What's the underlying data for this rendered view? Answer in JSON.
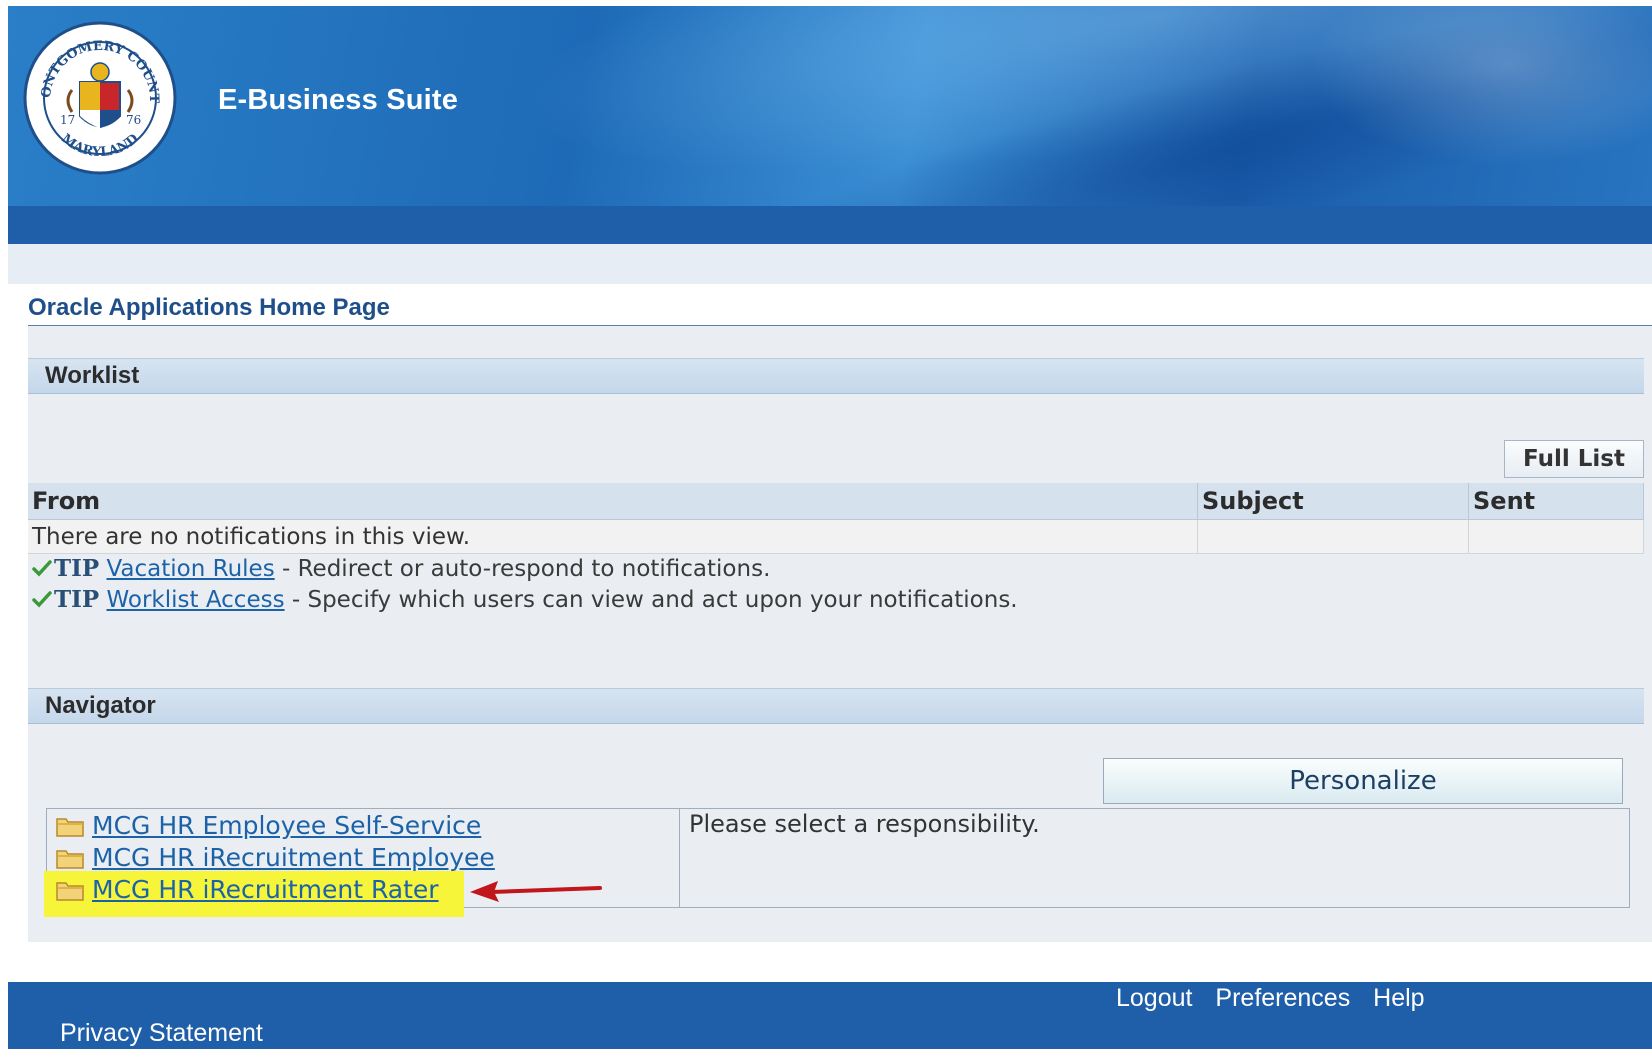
{
  "header": {
    "app_title": "E-Business Suite",
    "seal": {
      "top_text": "MONTGOMERY COUNTY",
      "bottom_text": "MARYLAND",
      "year_left": "17",
      "year_right": "76"
    }
  },
  "page": {
    "title": "Oracle Applications Home Page"
  },
  "worklist": {
    "section_title": "Worklist",
    "full_list_label": "Full List",
    "columns": [
      "From",
      "Subject",
      "Sent"
    ],
    "empty_message": "There are no notifications in this view.",
    "tips": [
      {
        "label": "TIP",
        "link": "Vacation Rules",
        "text": " - Redirect or auto-respond to notifications."
      },
      {
        "label": "TIP",
        "link": "Worklist Access",
        "text": " - Specify which users can view and act upon your notifications."
      }
    ]
  },
  "navigator": {
    "section_title": "Navigator",
    "personalize_label": "Personalize",
    "items": [
      {
        "label": "MCG HR Employee Self-Service"
      },
      {
        "label": "MCG HR iRecruitment Employee"
      },
      {
        "label": "MCG HR iRecruitment Rater",
        "highlighted": true
      }
    ],
    "message": "Please select a responsibility."
  },
  "footer": {
    "links": [
      "Logout",
      "Preferences",
      "Help"
    ],
    "privacy": "Privacy Statement"
  },
  "colors": {
    "header_blue": "#1f5ea8",
    "link": "#1b62a8",
    "highlight": "#f6f53a",
    "arrow": "#c0161c"
  }
}
